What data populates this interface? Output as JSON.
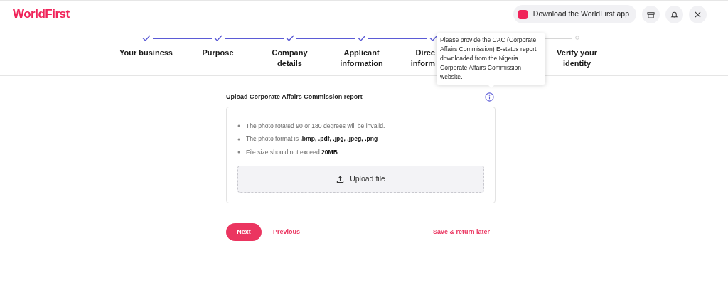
{
  "header": {
    "logo": "WorldFirst",
    "app_button": "Download the WorldFirst app"
  },
  "steps": [
    {
      "lines": [
        "Your business"
      ],
      "completed": true
    },
    {
      "lines": [
        "Purpose"
      ],
      "completed": true
    },
    {
      "lines": [
        "Company",
        "details"
      ],
      "completed": true
    },
    {
      "lines": [
        "Applicant",
        "information"
      ],
      "completed": true
    },
    {
      "lines": [
        "Direc",
        "inform"
      ],
      "completed": true,
      "cut_off": true
    },
    {
      "covered": true
    },
    {
      "lines": [
        "Verify your",
        "identity"
      ],
      "completed": false
    }
  ],
  "tooltip": "Please provide the CAC (Corporate Affairs Commission) E-status report downloaded from the Nigeria Corporate Affairs Commission website.",
  "upload": {
    "title": "Upload Corporate Affairs Commission report",
    "rules": [
      "The photo rotated 90 or 180 degrees will be invalid.",
      "The photo format is **.bmp, .pdf, .jpg, .jpeg, .png**",
      "File size should not exceed **20MB**"
    ],
    "button": "Upload file"
  },
  "actions": {
    "next": "Next",
    "previous": "Previous",
    "save": "Save & return later"
  }
}
